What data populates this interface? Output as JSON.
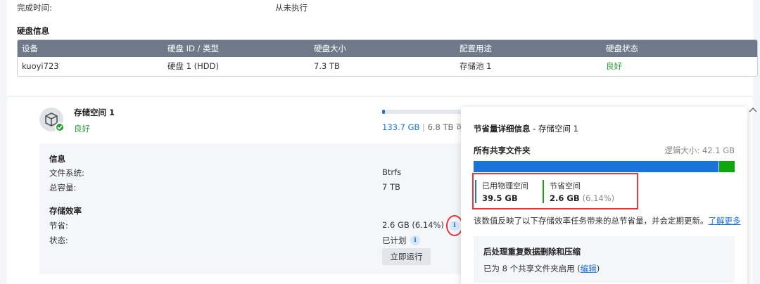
{
  "top": {
    "completed_label": "完成时间:",
    "completed_value": "从未执行",
    "disk_info_title": "硬盘信息",
    "table": {
      "headers": [
        "设备",
        "硬盘 ID / 类型",
        "硬盘大小",
        "配置用途",
        "硬盘状态"
      ],
      "rows": [
        [
          "kuoyi723",
          "硬盘 1 (HDD)",
          "7.3 TB",
          "存储池 1",
          "良好"
        ]
      ]
    }
  },
  "pool": {
    "name": "存储空间 1",
    "status": "良好",
    "usage_used": "133.7 GB",
    "usage_sep": "|",
    "usage_total": "6.8 TB 可",
    "usage_fraction": 0.02
  },
  "info": {
    "title": "信息",
    "filesystem_label": "文件系统:",
    "filesystem_value": "Btrfs",
    "capacity_label": "总容量:",
    "capacity_value": "7 TB",
    "efficiency_title": "存储效率",
    "savings_label": "节省:",
    "savings_value": "2.6 GB (6.14%)",
    "status_label": "状态:",
    "status_value": "已计划",
    "run_button": "立即运行",
    "info_glyph": "i"
  },
  "popover": {
    "title_bold": "节省量详细信息",
    "title_rest": " - 存储空间 1",
    "all_shares": "所有共享文件夹",
    "logical_size": "逻辑大小: 42.1 GB",
    "used_fraction": 0.938,
    "saved_fraction": 0.062,
    "used_label": "已用物理空间",
    "used_value": "39.5 GB",
    "saved_label": "节省空间",
    "saved_value": "2.6 GB",
    "saved_percent": "(6.14%)",
    "description": "该数值反映了以下存储效率任务带来的总节省量，并会定期更新。",
    "learn_more": "了解更多",
    "card_title": "后处理重复数据删除和压缩",
    "card_text_pre": "已为 8 个共享文件夹启用 (",
    "card_edit": "编辑",
    "card_text_post": ")"
  },
  "colors": {
    "accent_blue": "#1a73d9",
    "good_green": "#2a9d39",
    "saved_green": "#11a511",
    "highlight_red": "#e53935",
    "table_header": "#6e7a89"
  },
  "icons": [
    "cube-icon",
    "check-icon",
    "info-icon",
    "chevron-up-icon"
  ]
}
